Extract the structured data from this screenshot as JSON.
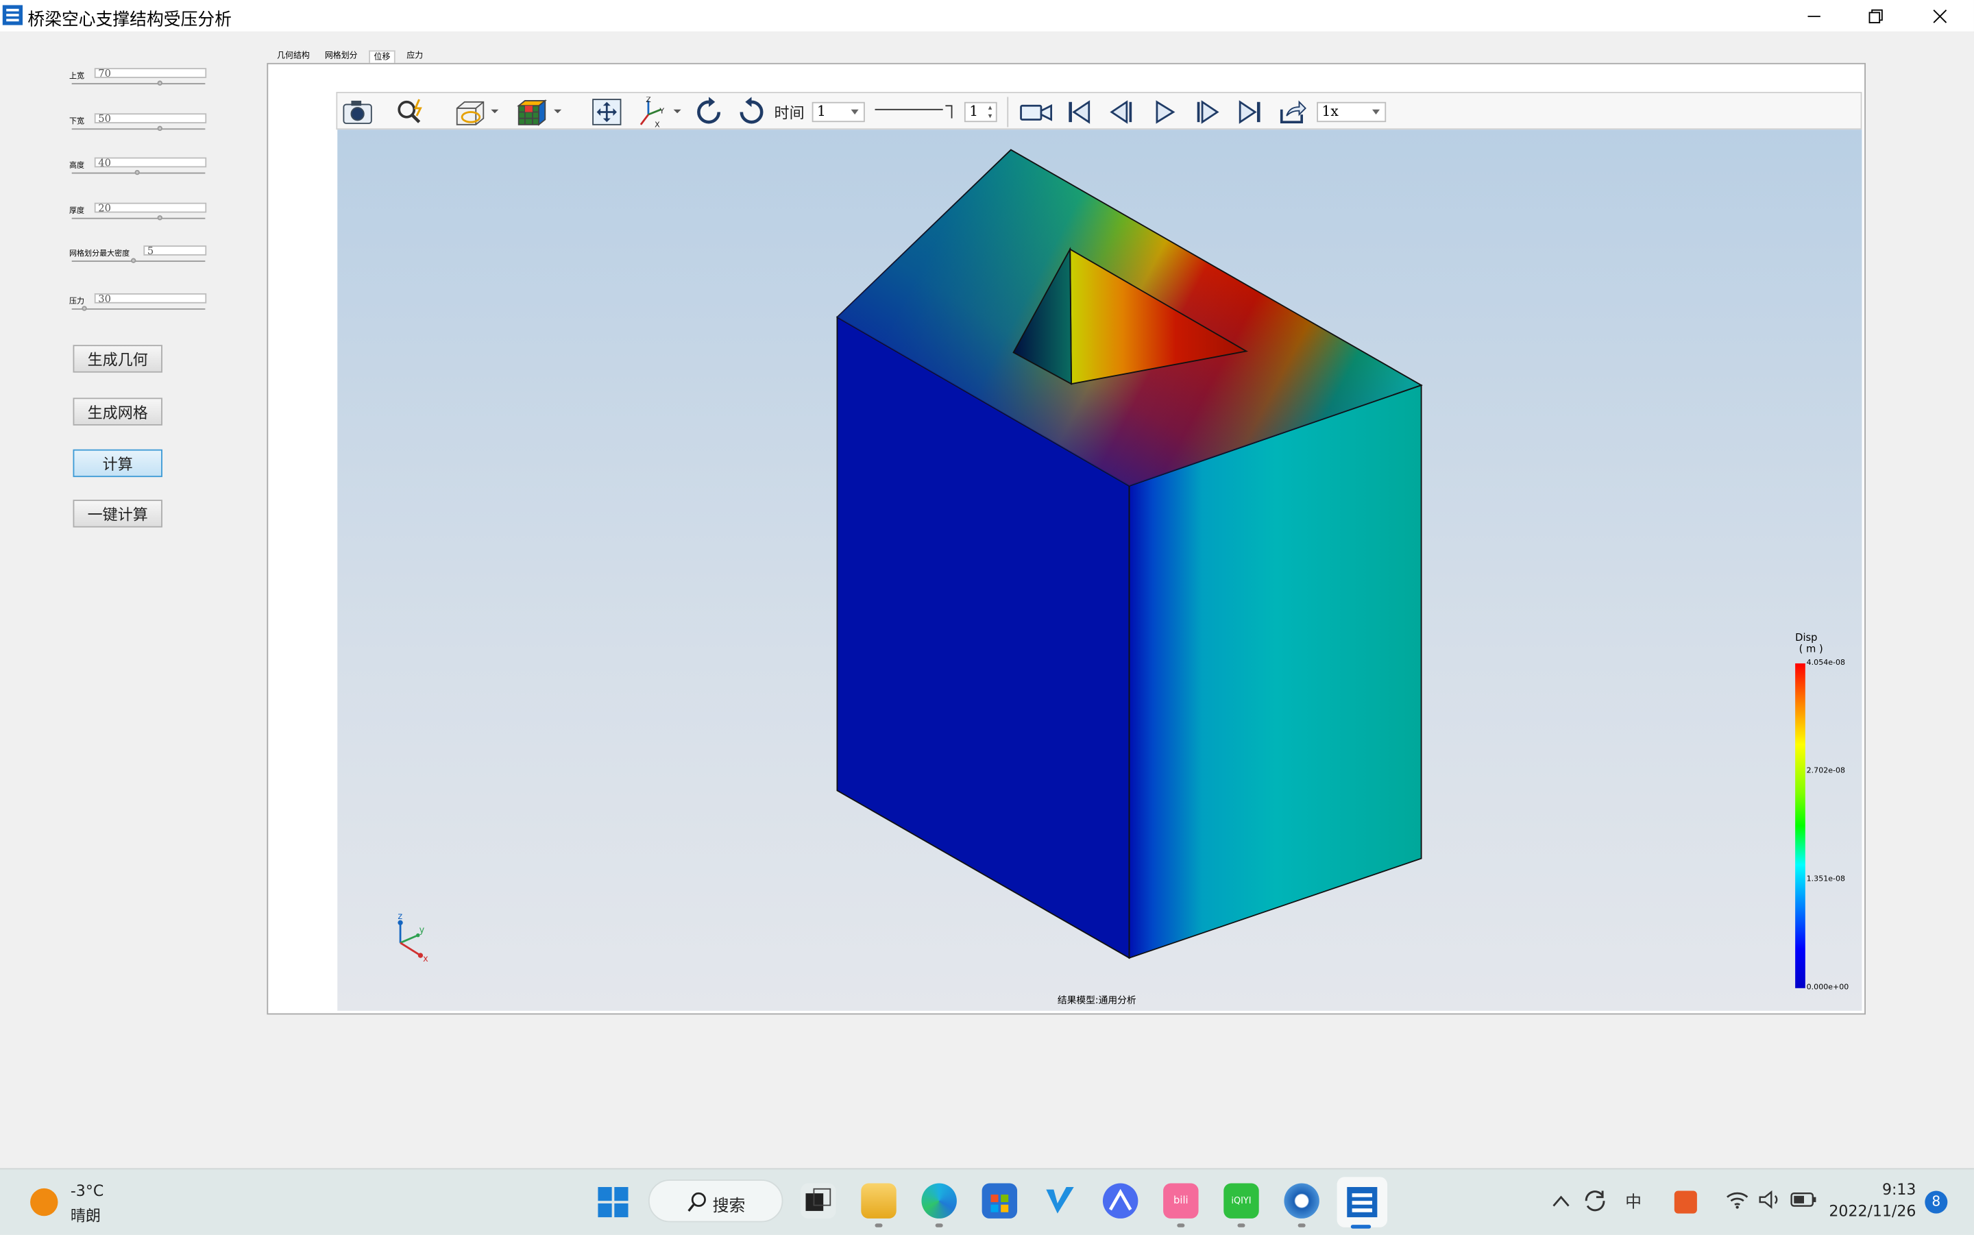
{
  "window": {
    "title": "桥梁空心支撑结构受压分析",
    "minimize_icon": "minimize-icon",
    "restore_icon": "restore-icon",
    "close_icon": "close-icon"
  },
  "params": [
    {
      "label": "上宽",
      "value": "70",
      "slider": 0.65
    },
    {
      "label": "下宽",
      "value": "50",
      "slider": 0.65
    },
    {
      "label": "高度",
      "value": "40",
      "slider": 0.48
    },
    {
      "label": "厚度",
      "value": "20",
      "slider": 0.65
    },
    {
      "label": "网格划分最大密度",
      "value": "5",
      "slider": 0.45
    },
    {
      "label": "压力",
      "value": "30",
      "slider": 0.08
    }
  ],
  "buttons": {
    "gen_geometry": "生成几何",
    "gen_mesh": "生成网格",
    "compute": "计算",
    "one_click": "一键计算"
  },
  "tabs": [
    "几何结构",
    "网格划分",
    "位移",
    "应力"
  ],
  "selected_tab": "位移",
  "toolbar": {
    "time_label": "时间",
    "time_value": "1",
    "frame_value": "1",
    "speed_value": "1x"
  },
  "viewport": {
    "status": "结果模型:通用分析",
    "legend": {
      "title": "Disp",
      "unit": "( m )",
      "values": [
        "4.054e-08",
        "2.702e-08",
        "1.351e-08",
        "0.000e+00"
      ]
    },
    "axes": {
      "x": "x",
      "y": "y",
      "z": "z"
    }
  },
  "taskbar": {
    "weather_temp": "-3°C",
    "weather_desc": "晴朗",
    "search_label": "搜索",
    "ime": "中",
    "time": "9:13",
    "date": "2022/11/26",
    "notification_count": "8"
  }
}
